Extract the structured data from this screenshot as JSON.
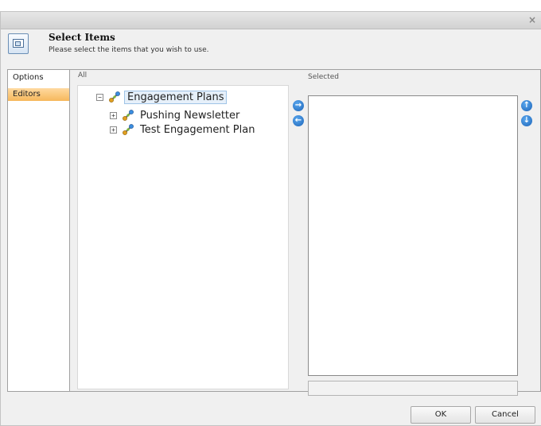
{
  "dialog": {
    "close_glyph": "×",
    "title": "Select Items",
    "subtitle": "Please select the items that you wish to use."
  },
  "tabs": [
    {
      "label": "Options",
      "active": false
    },
    {
      "label": "Editors",
      "active": true
    }
  ],
  "all_panel": {
    "label": "All",
    "tree": {
      "root": {
        "label": "Engagement Plans",
        "expander": "−",
        "icon": "engagement-plan-icon"
      },
      "children": [
        {
          "label": "Pushing Newsletter",
          "expander": "+",
          "icon": "engagement-plan-icon"
        },
        {
          "label": "Test Engagement Plan",
          "expander": "+",
          "icon": "engagement-plan-icon"
        }
      ]
    }
  },
  "selected_panel": {
    "label": "Selected",
    "items": []
  },
  "arrows": {
    "add": "→",
    "remove": "←",
    "up": "↑",
    "down": "↓"
  },
  "buttons": {
    "ok": "OK",
    "cancel": "Cancel"
  },
  "colors": {
    "active_tab": "#f6b85c",
    "arrow_blue": "#1c64b8",
    "root_highlight": "#e6f0fa"
  }
}
